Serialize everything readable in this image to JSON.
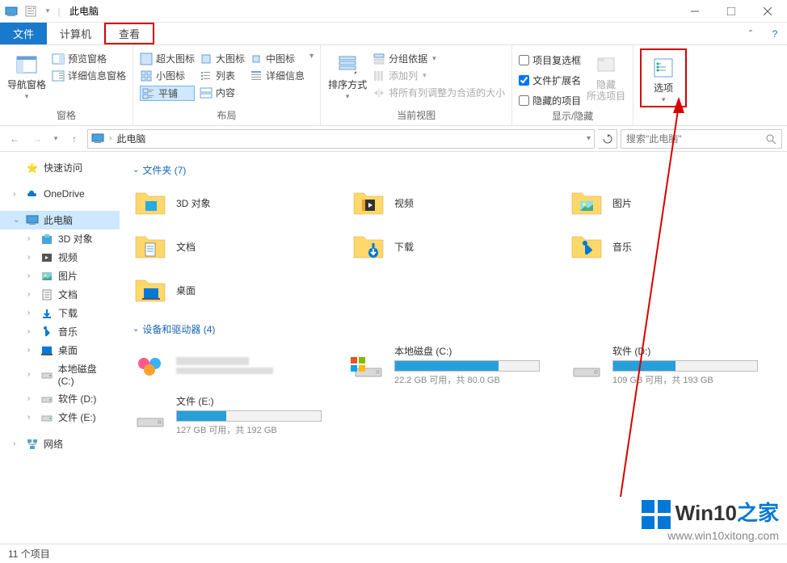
{
  "titlebar": {
    "title": "此电脑"
  },
  "tabs": {
    "file": "文件",
    "computer": "计算机",
    "view": "查看"
  },
  "ribbon": {
    "g1": {
      "label": "窗格",
      "nav": "导航窗格",
      "preview": "预览窗格",
      "details": "详细信息窗格"
    },
    "g2": {
      "label": "布局",
      "extraLarge": "超大图标",
      "large": "大图标",
      "medium": "中图标",
      "small": "小图标",
      "list": "列表",
      "detailsview": "详细信息",
      "tiles": "平铺",
      "content": "内容"
    },
    "g3": {
      "label": "当前视图",
      "sort": "排序方式",
      "group": "分组依据",
      "addcol": "添加列",
      "fitcols": "将所有列调整为合适的大小"
    },
    "g4": {
      "label": "显示/隐藏",
      "chkbox": "项目复选框",
      "ext": "文件扩展名",
      "hidden": "隐藏的项目",
      "hidebtn": "隐藏\n所选项目"
    },
    "g5": {
      "options": "选项"
    }
  },
  "addr": {
    "location": "此电脑",
    "searchPlaceholder": "搜索\"此电脑\""
  },
  "sidebar": {
    "quick": "快速访问",
    "onedrive": "OneDrive",
    "thispc": "此电脑",
    "items": [
      "3D 对象",
      "视频",
      "图片",
      "文档",
      "下载",
      "音乐",
      "桌面"
    ],
    "drives": [
      "本地磁盘 (C:)",
      "软件 (D:)",
      "文件 (E:)"
    ],
    "network": "网络"
  },
  "content": {
    "foldersHeader": "文件夹 (7)",
    "folders": [
      "3D 对象",
      "视频",
      "图片",
      "文档",
      "下载",
      "音乐",
      "桌面"
    ],
    "drivesHeader": "设备和驱动器 (4)",
    "drives": [
      {
        "name": "",
        "sub": "",
        "pct": 0,
        "special": true
      },
      {
        "name": "本地磁盘 (C:)",
        "sub": "22.2 GB 可用，共 80.0 GB",
        "pct": 72
      },
      {
        "name": "软件 (D:)",
        "sub": "109 GB 可用，共 193 GB",
        "pct": 43
      },
      {
        "name": "文件 (E:)",
        "sub": "127 GB 可用，共 192 GB",
        "pct": 34
      }
    ]
  },
  "status": {
    "text": "11 个项目"
  },
  "watermark": {
    "brand1": "Win10",
    "brand2": "之家",
    "url": "www.win10xitong.com"
  }
}
